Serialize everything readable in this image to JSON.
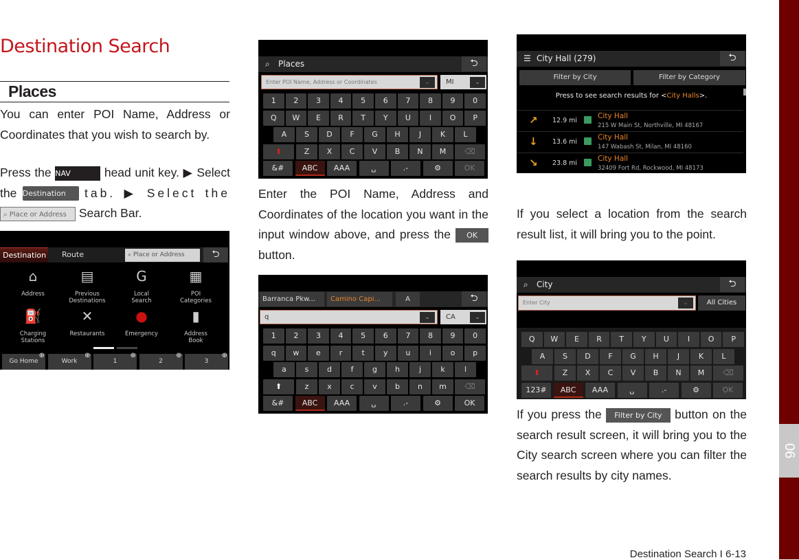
{
  "page": {
    "title": "Destination Search",
    "section": "Places",
    "chapter_tab": "06",
    "footer": "Destination Search I 6-13",
    "accent_color": "#c4161c",
    "sidebar_color": "#6e0000"
  },
  "col1": {
    "intro": "You can enter POI Name, Address or Coordinates that you wish to search by.",
    "step_press": "Press the",
    "nav_key": "NAV",
    "step_head": "head unit key. ▶ Select the",
    "dest_tab": "Destination",
    "step_tab": "tab. ▶ Select the",
    "place_bar": "Place or Address",
    "step_bar": "Search Bar."
  },
  "col2": {
    "text_before": "Enter the POI Name, Address and Coordinates of the location you want in the input window above, and press the",
    "ok_button": "OK",
    "text_after": "button."
  },
  "col3": {
    "text1": "If you select a location from the search result list, it will bring you to the point.",
    "text2_before": "If you press the",
    "filter_button": "Filter by City",
    "text2_after": "button on the search result screen, it will bring you to the City search screen where you can filter the search results by city names."
  },
  "screen1": {
    "tabs": [
      "Destination",
      "Route"
    ],
    "search_placeholder": "Place or Address",
    "items": [
      {
        "label1": "Address",
        "label2": "",
        "icon": "house-search-icon"
      },
      {
        "label1": "Previous",
        "label2": "Destinations",
        "icon": "folder-clock-icon"
      },
      {
        "label1": "Local",
        "label2": "Search",
        "icon": "google-icon"
      },
      {
        "label1": "POI",
        "label2": "Categories",
        "icon": "building-search-icon"
      },
      {
        "label1": "Charging",
        "label2": "Stations",
        "icon": "charging-station-icon"
      },
      {
        "label1": "Restaurants",
        "label2": "",
        "icon": "fork-spoon-icon"
      },
      {
        "label1": "Emergency",
        "label2": "",
        "icon": "siren-icon"
      },
      {
        "label1": "Address",
        "label2": "Book",
        "icon": "address-book-icon"
      }
    ],
    "page_index": 1,
    "page_count": 2,
    "favorites": [
      "Go Home",
      "Work",
      "1",
      "2",
      "3"
    ]
  },
  "screen2": {
    "title": "Places",
    "input_placeholder": "Enter POI Name, Address or Coordinates",
    "state": "MI",
    "keys": [
      [
        "1",
        "2",
        "3",
        "4",
        "5",
        "6",
        "7",
        "8",
        "9",
        "0"
      ],
      [
        "Q",
        "W",
        "E",
        "R",
        "T",
        "Y",
        "U",
        "I",
        "O",
        "P"
      ],
      [
        "A",
        "S",
        "D",
        "F",
        "G",
        "H",
        "J",
        "K",
        "L"
      ],
      [
        "⬆",
        "Z",
        "X",
        "C",
        "V",
        "B",
        "N",
        "M",
        "⌫"
      ],
      [
        "&#",
        "ABC",
        "AAA",
        "␣",
        ".-",
        "⚙",
        "OK"
      ]
    ],
    "shift_color": "#e02020",
    "ok_disabled": true
  },
  "screen3": {
    "title": "City Hall (279)",
    "filter_city": "Filter by City",
    "filter_category": "Filter by Category",
    "message_before": "Press to see search results for <",
    "message_term": "City Halls",
    "message_after": ">.",
    "results": [
      {
        "direction": "↗",
        "distance": "12.9 mi",
        "name": "City Hall",
        "address": "215 W Main St, Northville, MI 48167"
      },
      {
        "direction": "↓",
        "distance": "13.6 mi",
        "name": "City Hall",
        "address": "147 Wabash St, Milan, MI 48160"
      },
      {
        "direction": "↘",
        "distance": "23.8 mi",
        "name": "City Hall",
        "address": "32409 Fort Rd, Rockwood, MI 48173"
      }
    ]
  },
  "screen4": {
    "suggestions": [
      "Barranca Pkw...",
      "Camino Capi...",
      "A"
    ],
    "input_value": "q",
    "state": "CA",
    "keys": [
      [
        "1",
        "2",
        "3",
        "4",
        "5",
        "6",
        "7",
        "8",
        "9",
        "0"
      ],
      [
        "q",
        "w",
        "e",
        "r",
        "t",
        "y",
        "u",
        "i",
        "o",
        "p"
      ],
      [
        "a",
        "s",
        "d",
        "f",
        "g",
        "h",
        "j",
        "k",
        "l"
      ],
      [
        "⬆",
        "z",
        "x",
        "c",
        "v",
        "b",
        "n",
        "m",
        "⌫"
      ],
      [
        "&#",
        "ABC",
        "AAA",
        "␣",
        ".-",
        "⚙",
        "OK"
      ]
    ],
    "shift_color": "#ffffff",
    "ok_disabled": false
  },
  "screen5": {
    "title": "City",
    "input_placeholder": "Enter City",
    "all_cities": "All Cities",
    "keys": [
      [
        "Q",
        "W",
        "E",
        "R",
        "T",
        "Y",
        "U",
        "I",
        "O",
        "P"
      ],
      [
        "A",
        "S",
        "D",
        "F",
        "G",
        "H",
        "J",
        "K",
        "L"
      ],
      [
        "⬆",
        "Z",
        "X",
        "C",
        "V",
        "B",
        "N",
        "M",
        "⌫"
      ],
      [
        "123#",
        "ABC",
        "AAA",
        "␣",
        ".-",
        "⚙",
        "OK"
      ]
    ],
    "shift_color": "#e02020",
    "ok_disabled": true
  }
}
